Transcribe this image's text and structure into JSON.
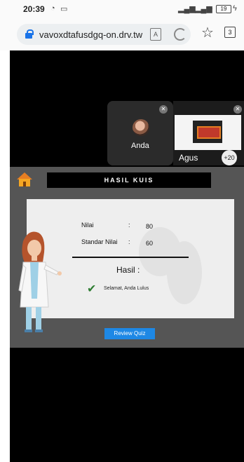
{
  "status_bar": {
    "time": "20:39",
    "battery": "19"
  },
  "browser": {
    "url": "vavoxdtafusdgq-on.drv.tw",
    "tab_count": "3"
  },
  "meeting": {
    "self_label": "Anda",
    "participant_label": "Agus",
    "more_count": "+20"
  },
  "quiz": {
    "title": "HASIL KUIS",
    "nilai_label": "Nilai",
    "nilai_sep": ":",
    "nilai_value": "80",
    "standar_label": "Standar Nilai",
    "standar_sep": ":",
    "standar_value": "60",
    "hasil_label": "Hasil :",
    "result_text": "Selamat, Anda Lulus",
    "review_button": "Review Quiz"
  },
  "colors": {
    "review": "#1e88e5",
    "check": "#2e7d32",
    "panel": "#555555"
  },
  "icons": [
    "wifi-icon",
    "lock-icon",
    "reader-icon",
    "reload-icon",
    "star-icon",
    "tabs-icon",
    "mic-off-icon",
    "home-icon",
    "check-icon"
  ]
}
